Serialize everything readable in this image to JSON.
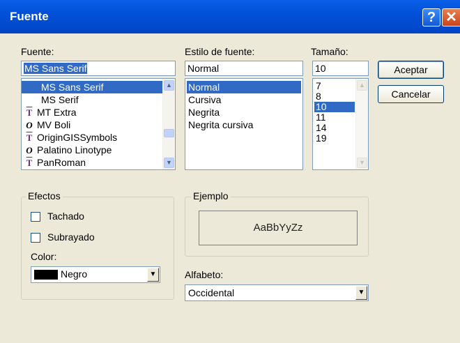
{
  "window": {
    "title": "Fuente",
    "help_glyph": "?",
    "close_glyph": "✕"
  },
  "font": {
    "label": "Fuente:",
    "value": "MS Sans Serif",
    "items": [
      {
        "name": "MS Sans Serif",
        "icon": "none",
        "selected": true
      },
      {
        "name": "MS Serif",
        "icon": "none"
      },
      {
        "name": "MT Extra",
        "icon": "truetype-icon"
      },
      {
        "name": "MV Boli",
        "icon": "opentype-icon"
      },
      {
        "name": "OriginGISSymbols",
        "icon": "truetype-icon"
      },
      {
        "name": "Palatino Linotype",
        "icon": "opentype-icon"
      },
      {
        "name": "PanRoman",
        "icon": "truetype-icon"
      }
    ]
  },
  "style": {
    "label": "Estilo de fuente:",
    "value": "Normal",
    "items": [
      "Normal",
      "Cursiva",
      "Negrita",
      "Negrita cursiva"
    ],
    "selected_index": 0
  },
  "size": {
    "label": "Tamaño:",
    "value": "10",
    "items": [
      "7",
      "8",
      "10",
      "11",
      "14",
      "19"
    ],
    "selected_index": 2
  },
  "buttons": {
    "ok": "Aceptar",
    "cancel": "Cancelar"
  },
  "effects": {
    "label": "Efectos",
    "strikeout": "Tachado",
    "underline": "Subrayado",
    "color_label": "Color:",
    "color_value": "Negro",
    "color_swatch": "#000000"
  },
  "sample": {
    "label": "Ejemplo",
    "text": "AaBbYyZz"
  },
  "script": {
    "label": "Alfabeto:",
    "value": "Occidental"
  },
  "colors": {
    "selection": "#316ac5",
    "titlebar": "#0250d8"
  }
}
